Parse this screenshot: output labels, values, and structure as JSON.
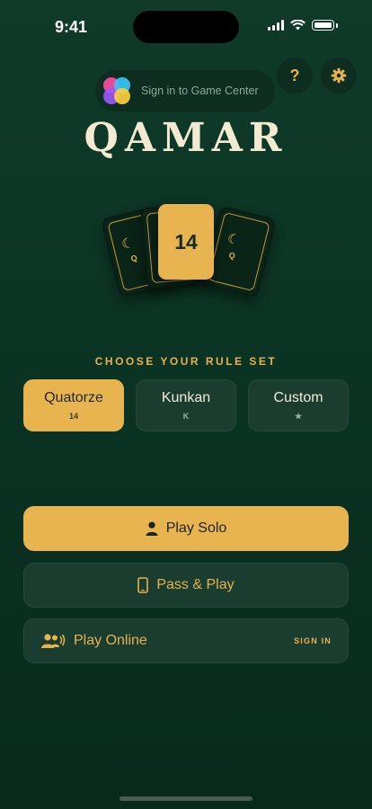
{
  "status_bar": {
    "time": "9:41"
  },
  "game_center": {
    "label": "Sign in to Game Center"
  },
  "header": {
    "help_label": "?",
    "title": "QAMAR"
  },
  "cards": {
    "front_value": "14",
    "back_letter": "Q",
    "back_symbol": "☾"
  },
  "rule_set": {
    "heading": "CHOOSE YOUR RULE SET",
    "options": [
      {
        "name": "Quatorze",
        "sub": "14",
        "selected": true
      },
      {
        "name": "Kunkan",
        "sub": "K",
        "selected": false
      },
      {
        "name": "Custom",
        "sub": "★",
        "selected": false
      }
    ]
  },
  "actions": {
    "solo": {
      "label": "Play Solo",
      "icon": "person-icon"
    },
    "pass": {
      "label": "Pass & Play",
      "icon": "phone-icon"
    },
    "online": {
      "label": "Play Online",
      "icon": "people-icon",
      "badge": "SIGN IN"
    }
  },
  "colors": {
    "accent": "#e8b450",
    "background": "#0b3323",
    "surface": "#1a3d2f"
  }
}
